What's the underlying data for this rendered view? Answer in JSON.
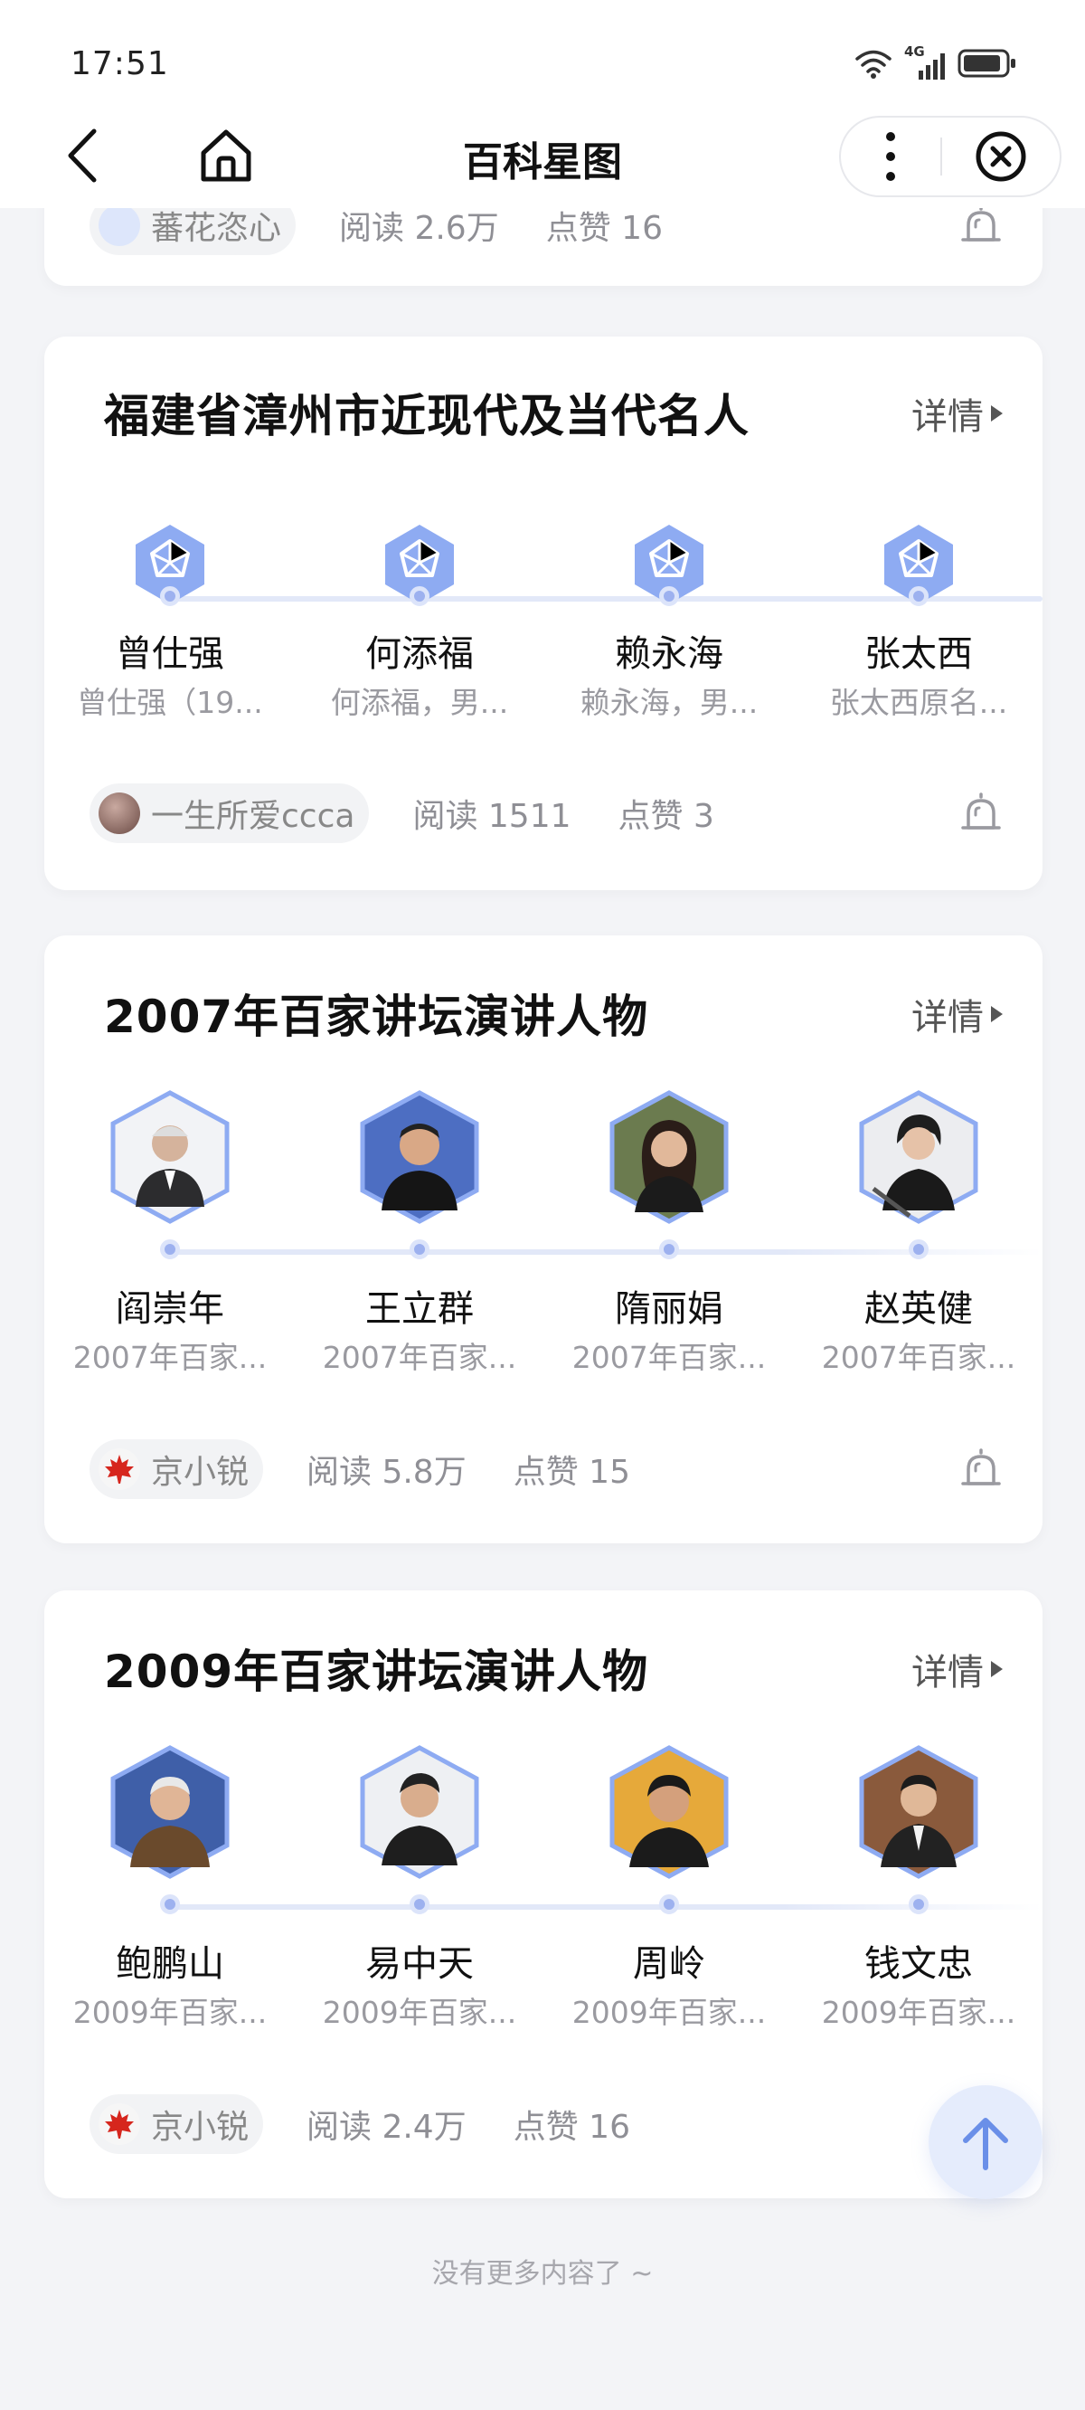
{
  "status_bar": {
    "time": "17:51",
    "network": "4G"
  },
  "nav": {
    "title": "百科星图"
  },
  "cards": [
    {
      "title": "",
      "detail_label": "",
      "author": "蕃花恣心",
      "reads": "阅读 2.6万",
      "likes": "点赞 16",
      "people": []
    },
    {
      "title": "福建省漳州市近现代及当代名人",
      "detail_label": "详情",
      "author": "一生所爱ccca",
      "reads": "阅读 1511",
      "likes": "点赞 3",
      "people": [
        {
          "name": "曾仕强",
          "desc": "曾仕强（19..."
        },
        {
          "name": "何添福",
          "desc": "何添福，男..."
        },
        {
          "name": "赖永海",
          "desc": "赖永海，男..."
        },
        {
          "name": "张太西",
          "desc": "张太西原名..."
        }
      ]
    },
    {
      "title": "2007年百家讲坛演讲人物",
      "detail_label": "详情",
      "author": "京小锐",
      "reads": "阅读 5.8万",
      "likes": "点赞 15",
      "people": [
        {
          "name": "阎崇年",
          "desc": "2007年百家..."
        },
        {
          "name": "王立群",
          "desc": "2007年百家..."
        },
        {
          "name": "隋丽娟",
          "desc": "2007年百家..."
        },
        {
          "name": "赵英健",
          "desc": "2007年百家..."
        }
      ]
    },
    {
      "title": "2009年百家讲坛演讲人物",
      "detail_label": "详情",
      "author": "京小锐",
      "reads": "阅读 2.4万",
      "likes": "点赞 16",
      "people": [
        {
          "name": "鲍鹏山",
          "desc": "2009年百家..."
        },
        {
          "name": "易中天",
          "desc": "2009年百家..."
        },
        {
          "name": "周岭",
          "desc": "2009年百家..."
        },
        {
          "name": "钱文忠",
          "desc": "2009年百家..."
        }
      ]
    }
  ],
  "footer": {
    "end_text": "没有更多内容了 ~"
  },
  "colors": {
    "accent": "#7b9cf0",
    "hex_fill": "#8eabf2",
    "timeline": "#e2e8f8"
  }
}
